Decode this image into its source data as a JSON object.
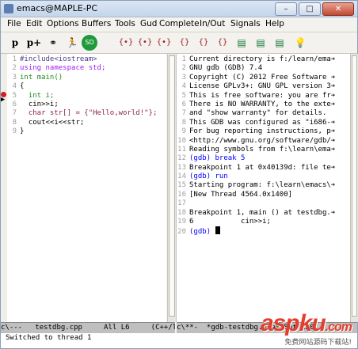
{
  "window": {
    "title": "emacs@MAPLE-PC",
    "minimize": "–",
    "maximize": "□",
    "close": "✕"
  },
  "menu": [
    "File",
    "Edit",
    "Options",
    "Buffers",
    "Tools",
    "Gud",
    "Complete",
    "In/Out",
    "Signals",
    "Help"
  ],
  "toolbar": {
    "icons": [
      "p-icon",
      "p-plus-icon",
      "watch-icon",
      "run-icon",
      "stop-icon",
      "step-into-icon",
      "step-over-icon",
      "step-out-icon",
      "up-icon",
      "down-icon",
      "finish-icon",
      "save-icon",
      "info-icon"
    ],
    "glyphs": [
      "p",
      "p+",
      "⚭",
      "🏃",
      "SD",
      "{•}",
      "{•}",
      "{•}",
      "{}",
      "{}",
      "{}",
      "▤",
      "💡"
    ]
  },
  "source": {
    "lines": [
      {
        "n": "1",
        "code": "#include<iostream>"
      },
      {
        "n": "2",
        "code": "using namespace std;"
      },
      {
        "n": "3",
        "code": "int main()"
      },
      {
        "n": "4",
        "code": "{"
      },
      {
        "n": "5",
        "code": "  int i;"
      },
      {
        "n": "6",
        "code": "  cin>>i;"
      },
      {
        "n": "7",
        "code": "  char str[] = {\"Hello,world!\"};"
      },
      {
        "n": "8",
        "code": "  cout<<i<<str;"
      },
      {
        "n": "9",
        "code": "}"
      }
    ]
  },
  "gdb": {
    "lines": [
      {
        "n": "1",
        "text": "Current directory is f:/learn/ema➔"
      },
      {
        "n": "2",
        "text": "GNU gdb (GDB) 7.4"
      },
      {
        "n": "3",
        "text": "Copyright (C) 2012 Free Software ➔"
      },
      {
        "n": "4",
        "text": "License GPLv3+: GNU GPL version 3➔"
      },
      {
        "n": "5",
        "text": "This is free software: you are fr➔"
      },
      {
        "n": "6",
        "text": "There is NO WARRANTY, to the exte➔"
      },
      {
        "n": "7",
        "text": "and \"show warranty\" for details."
      },
      {
        "n": "8",
        "text": "This GDB was configured as \"i686-➔"
      },
      {
        "n": "9",
        "text": "For bug reporting instructions, p➔"
      },
      {
        "n": "10",
        "text": "<http://www.gnu.org/software/gdb/➔"
      },
      {
        "n": "11",
        "text": "Reading symbols from f:\\learn\\ema➔"
      },
      {
        "n": "12",
        "text": "(gdb) break 5"
      },
      {
        "n": "13",
        "text": "Breakpoint 1 at 0x40139d: file te➔"
      },
      {
        "n": "14",
        "text": "(gdb) run"
      },
      {
        "n": "15",
        "text": "Starting program: f:\\learn\\emacs\\➔"
      },
      {
        "n": "16",
        "text": "[New Thread 4564.0x1400]"
      },
      {
        "n": "17",
        "text": ""
      },
      {
        "n": "18",
        "text": "Breakpoint 1, main () at testdbg.➔"
      },
      {
        "n": "19",
        "text": "6           cin>>i;"
      },
      {
        "n": "20",
        "text": "(gdb) "
      }
    ]
  },
  "modeline": {
    "left": "c\\---   testdbg.cpp     All L6     (C++/l",
    "right": "c\\**-  *gdb-testdbg.exe* Bot L20"
  },
  "echo": "Switched to thread 1",
  "watermark": {
    "brand": "aspku",
    "domain": ".com",
    "sub": "免费网站源码下载站!"
  },
  "colors": {
    "keyword": "#a020f0",
    "preprocessor": "#483d8b",
    "string": "#8b2252",
    "prompt": "#0000ff",
    "breakpoint": "#d02020"
  }
}
